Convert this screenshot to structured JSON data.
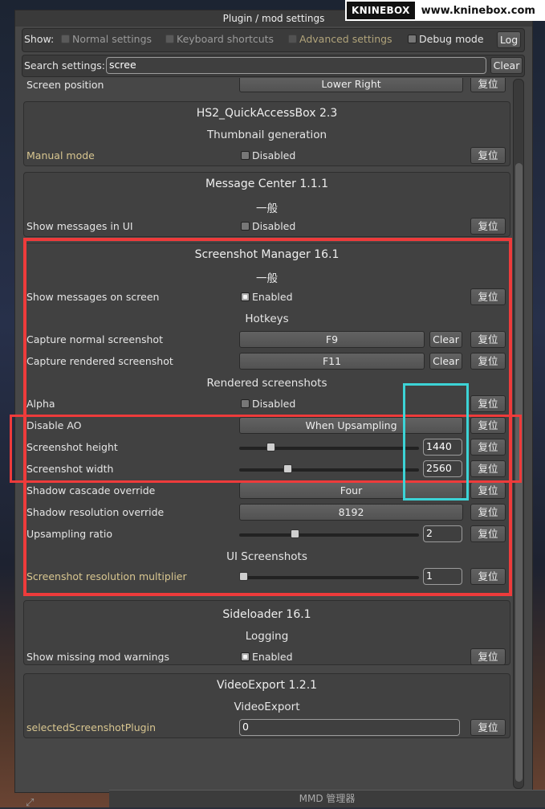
{
  "window_title": "Plugin / mod settings",
  "watermark": {
    "logo": "KNINEBOX",
    "url": "www.kninebox.com"
  },
  "filter": {
    "show_label": "Show:",
    "normal": "Normal settings",
    "keyboard": "Keyboard shortcuts",
    "advanced": "Advanced settings",
    "debug": "Debug mode",
    "log_button": "Log"
  },
  "search": {
    "label": "Search settings:",
    "value": "scree",
    "clear_button": "Clear"
  },
  "reset_label": "复位",
  "clear_label": "Clear",
  "top_partial": {
    "label": "Screen position",
    "value": "Lower Right"
  },
  "quickaccess": {
    "title": "HS2_QuickAccessBox 2.3",
    "section": "Thumbnail generation",
    "setting_label": "Manual mode",
    "value": "Disabled"
  },
  "message_center": {
    "title": "Message Center 1.1.1",
    "section": "一般",
    "setting_label": "Show messages in UI",
    "value": "Disabled"
  },
  "screenshot_manager": {
    "title": "Screenshot Manager 16.1",
    "section_general": "一般",
    "show_messages_label": "Show messages on screen",
    "show_messages_value": "Enabled",
    "section_hotkeys": "Hotkeys",
    "capture_normal_label": "Capture normal screenshot",
    "capture_normal_value": "F9",
    "capture_rendered_label": "Capture rendered screenshot",
    "capture_rendered_value": "F11",
    "section_rendered": "Rendered screenshots",
    "alpha_label": "Alpha",
    "alpha_value": "Disabled",
    "disable_ao_label": "Disable AO",
    "disable_ao_value": "When Upsampling",
    "height_label": "Screenshot height",
    "height_value": "1440",
    "height_slider": 0.16,
    "width_label": "Screenshot width",
    "width_value": "2560",
    "width_slider": 0.26,
    "shadow_cascade_label": "Shadow cascade override",
    "shadow_cascade_value": "Four",
    "shadow_res_label": "Shadow resolution override",
    "shadow_res_value": "8192",
    "upsampling_label": "Upsampling ratio",
    "upsampling_value": "2",
    "upsampling_slider": 0.3,
    "section_ui": "UI Screenshots",
    "multiplier_label": "Screenshot resolution multiplier",
    "multiplier_value": "1",
    "multiplier_slider": 0.0
  },
  "sideloader": {
    "title": "Sideloader 16.1",
    "section": "Logging",
    "setting_label": "Show missing mod warnings",
    "value": "Enabled"
  },
  "video_export": {
    "title": "VideoExport 1.2.1",
    "section": "VideoExport",
    "setting_label": "selectedScreenshotPlugin",
    "value": "0"
  },
  "bottom_bar": "MMD 管理器",
  "colors": {
    "highlight_red": "#ee3b3b",
    "highlight_cyan": "#3cd3d6",
    "warning_label": "#d8c690"
  }
}
